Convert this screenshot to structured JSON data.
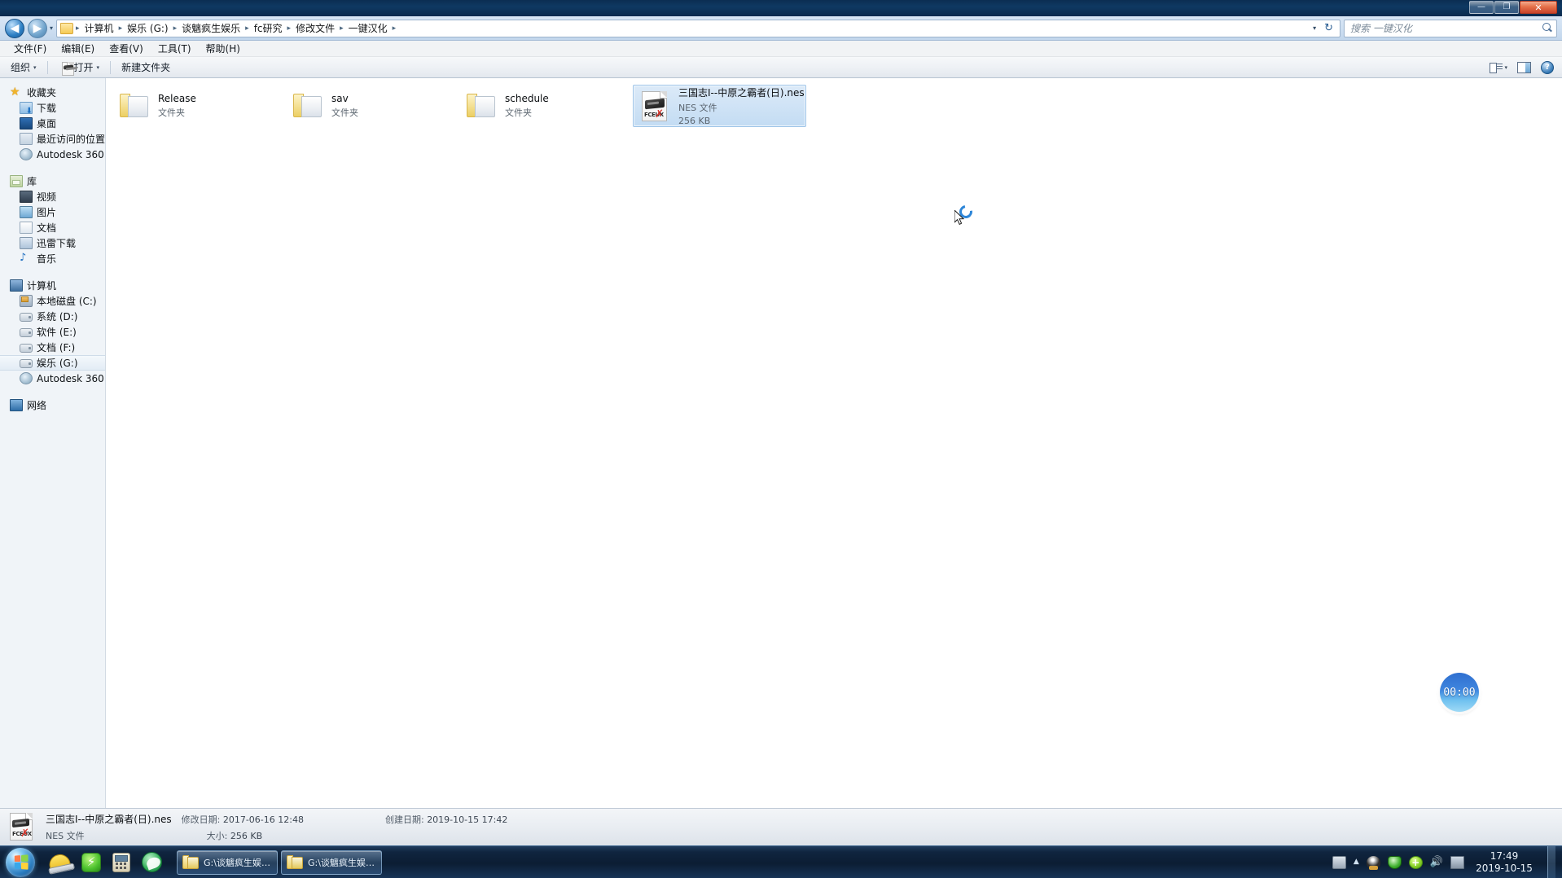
{
  "window": {
    "minimize_label": "—",
    "maximize_label": "❐",
    "close_label": "✕"
  },
  "address_bar": {
    "back_label": "◀",
    "forward_label": "▶",
    "history_caret": "▾",
    "breadcrumbs": [
      "计算机",
      "娱乐 (G:)",
      "谈魑疯生娱乐",
      "fc研究",
      "修改文件",
      "一键汉化"
    ],
    "separator": "▸",
    "dropdown_caret": "▾",
    "refresh_label": "↻",
    "search_placeholder": "搜索 一键汉化"
  },
  "menu": {
    "items": [
      {
        "label": "文件(F)"
      },
      {
        "label": "编辑(E)"
      },
      {
        "label": "查看(V)"
      },
      {
        "label": "工具(T)"
      },
      {
        "label": "帮助(H)"
      }
    ]
  },
  "toolbar": {
    "organize_label": "组织",
    "open_label": "打开",
    "new_folder_label": "新建文件夹",
    "caret": "▾",
    "help_label": "?"
  },
  "sidebar": {
    "groups": [
      {
        "name": "favorites",
        "header": {
          "label": "收藏夹",
          "icon": "star-icon"
        },
        "items": [
          {
            "label": "下载",
            "icon": "downloads-icon"
          },
          {
            "label": "桌面",
            "icon": "desktop-icon"
          },
          {
            "label": "最近访问的位置",
            "icon": "recent-places-icon"
          },
          {
            "label": "Autodesk 360",
            "icon": "autodesk-icon"
          }
        ]
      },
      {
        "name": "libraries",
        "header": {
          "label": "库",
          "icon": "library-icon"
        },
        "items": [
          {
            "label": "视频",
            "icon": "video-icon"
          },
          {
            "label": "图片",
            "icon": "picture-icon"
          },
          {
            "label": "文档",
            "icon": "document-icon"
          },
          {
            "label": "迅雷下载",
            "icon": "thunder-download-icon"
          },
          {
            "label": "音乐",
            "icon": "music-icon"
          }
        ]
      },
      {
        "name": "computer",
        "header": {
          "label": "计算机",
          "icon": "computer-icon"
        },
        "items": [
          {
            "label": "本地磁盘 (C:)",
            "icon": "system-drive-icon",
            "selected": false
          },
          {
            "label": "系统 (D:)",
            "icon": "drive-icon",
            "selected": false
          },
          {
            "label": "软件 (E:)",
            "icon": "drive-icon",
            "selected": false
          },
          {
            "label": "文档 (F:)",
            "icon": "drive-icon",
            "selected": false
          },
          {
            "label": "娱乐 (G:)",
            "icon": "drive-icon",
            "selected": true
          },
          {
            "label": "Autodesk 360",
            "icon": "autodesk-icon",
            "selected": false
          }
        ]
      },
      {
        "name": "network",
        "header": {
          "label": "网络",
          "icon": "network-icon"
        },
        "items": []
      }
    ]
  },
  "file_list": {
    "items": [
      {
        "name": "Release",
        "type": "文件夹",
        "size": "",
        "icon": "folder-icon",
        "selected": false
      },
      {
        "name": "sav",
        "type": "文件夹",
        "size": "",
        "icon": "folder-icon",
        "selected": false
      },
      {
        "name": "schedule",
        "type": "文件夹",
        "size": "",
        "icon": "folder-icon",
        "selected": false
      },
      {
        "name": "三国志Ⅰ--中原之霸者(日).nes",
        "type": "NES 文件",
        "size": "256 KB",
        "icon": "nes-file-icon",
        "selected": true
      }
    ],
    "nes_icon_label": "FCEUX"
  },
  "timer_widget": {
    "value": "00:00"
  },
  "details_pane": {
    "file_name": "三国志Ⅰ--中原之霸者(日).nes",
    "file_type": "NES 文件",
    "modified_label": "修改日期:",
    "modified_value": "2017-06-16 12:48",
    "created_label": "创建日期:",
    "created_value": "2019-10-15 17:42",
    "size_label": "大小:",
    "size_value": "256 KB"
  },
  "taskbar": {
    "start_label": "开始",
    "quick_launch": [
      {
        "name": "hat-icon"
      },
      {
        "name": "thunder-icon"
      },
      {
        "name": "calculator-icon"
      },
      {
        "name": "browser-icon"
      }
    ],
    "tasks": [
      {
        "label": "G:\\谈魑疯生娱乐\\..."
      },
      {
        "label": "G:\\谈魑疯生娱乐\\..."
      }
    ],
    "tray": [
      {
        "name": "keyboard-icon"
      },
      {
        "name": "show-hidden-icons-icon",
        "glyph": "▲"
      },
      {
        "name": "qq-icon"
      },
      {
        "name": "security-shield-icon"
      },
      {
        "name": "updater-icon",
        "glyph": "+"
      },
      {
        "name": "volume-icon",
        "glyph": "🔊"
      },
      {
        "name": "network-icon"
      }
    ],
    "clock_time": "17:49",
    "clock_date": "2019-10-15"
  }
}
